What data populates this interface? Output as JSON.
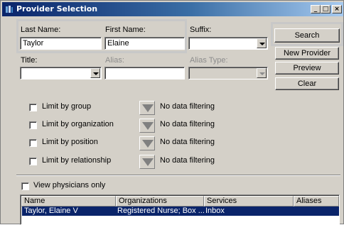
{
  "window": {
    "title": "Provider Selection",
    "controls": {
      "minimize": "_",
      "maximize": "□",
      "close": "×"
    }
  },
  "search": {
    "last_name_label": "Last Name:",
    "last_name_value": "Taylor",
    "first_name_label": "First Name:",
    "first_name_value": "Elaine",
    "suffix_label": "Suffix:",
    "suffix_value": "",
    "title_label": "Title:",
    "title_value": "",
    "alias_label": "Alias:",
    "alias_value": "",
    "alias_type_label": "Alias Type:",
    "alias_type_value": ""
  },
  "buttons": {
    "search": "Search",
    "new_provider": "New Provider",
    "preview": "Preview",
    "clear": "Clear"
  },
  "filters": [
    {
      "label": "Limit by group",
      "status": "No data filtering"
    },
    {
      "label": "Limit by organization",
      "status": "No data filtering"
    },
    {
      "label": "Limit by position",
      "status": "No data filtering"
    },
    {
      "label": "Limit by relationship",
      "status": "No data filtering"
    }
  ],
  "view_physicians_only": "View physicians only",
  "results": {
    "columns": [
      "Name",
      "Organizations",
      "Services",
      "Aliases"
    ],
    "rows": [
      {
        "name": "Taylor, Elaine V",
        "organizations": "Registered Nurse; Box ...",
        "services": "Inbox",
        "aliases": ""
      }
    ]
  },
  "colors": {
    "title_bar": "#0a246a",
    "selection": "#0a246a",
    "window_face": "#d4d0c8"
  }
}
